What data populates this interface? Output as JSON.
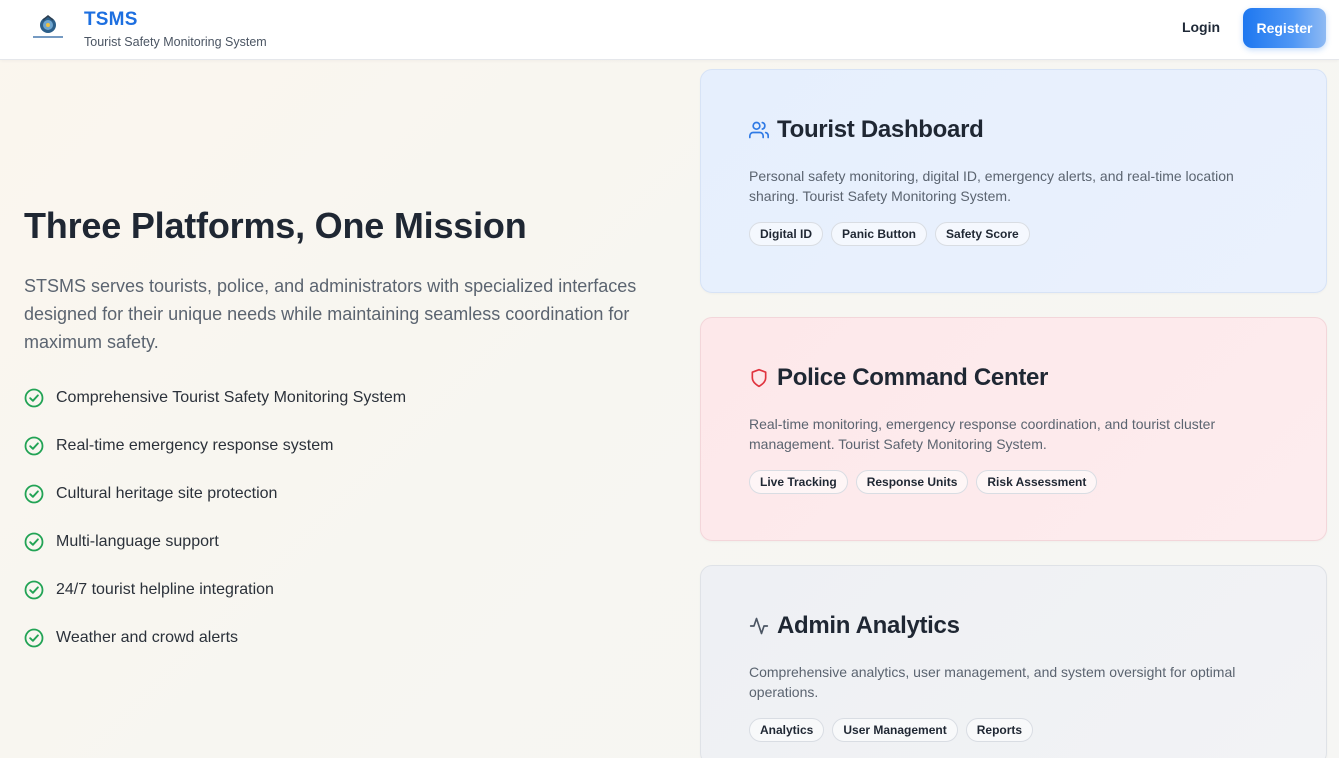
{
  "header": {
    "brand_title": "TSMS",
    "brand_subtitle": "Tourist Safety Monitoring System",
    "login_label": "Login",
    "register_label": "Register"
  },
  "hero": {
    "title": "Three Platforms, One Mission",
    "description": "STSMS serves tourists, police, and administrators with specialized interfaces designed for their unique needs while maintaining seamless coordination for maximum safety.",
    "features": [
      "Comprehensive Tourist Safety Monitoring System",
      "Real-time emergency response system",
      "Cultural heritage site protection",
      "Multi-language support",
      "24/7 tourist helpline integration",
      "Weather and crowd alerts"
    ]
  },
  "cards": [
    {
      "icon": "users-icon",
      "accent": "#2f7ae5",
      "title": "Tourist Dashboard",
      "description": "Personal safety monitoring, digital ID, emergency alerts, and real-time location sharing. Tourist Safety Monitoring System.",
      "tags": [
        "Digital ID",
        "Panic Button",
        "Safety Score"
      ]
    },
    {
      "icon": "shield-icon",
      "accent": "#e0343f",
      "title": "Police Command Center",
      "description": "Real-time monitoring, emergency response coordination, and tourist cluster management. Tourist Safety Monitoring System.",
      "tags": [
        "Live Tracking",
        "Response Units",
        "Risk Assessment"
      ]
    },
    {
      "icon": "activity-icon",
      "accent": "#4b5563",
      "title": "Admin Analytics",
      "description": "Comprehensive analytics, user management, and system oversight for optimal operations.",
      "tags": [
        "Analytics",
        "User Management",
        "Reports"
      ]
    }
  ],
  "colors": {
    "brand": "#1d6fe0",
    "check": "#22a355"
  }
}
